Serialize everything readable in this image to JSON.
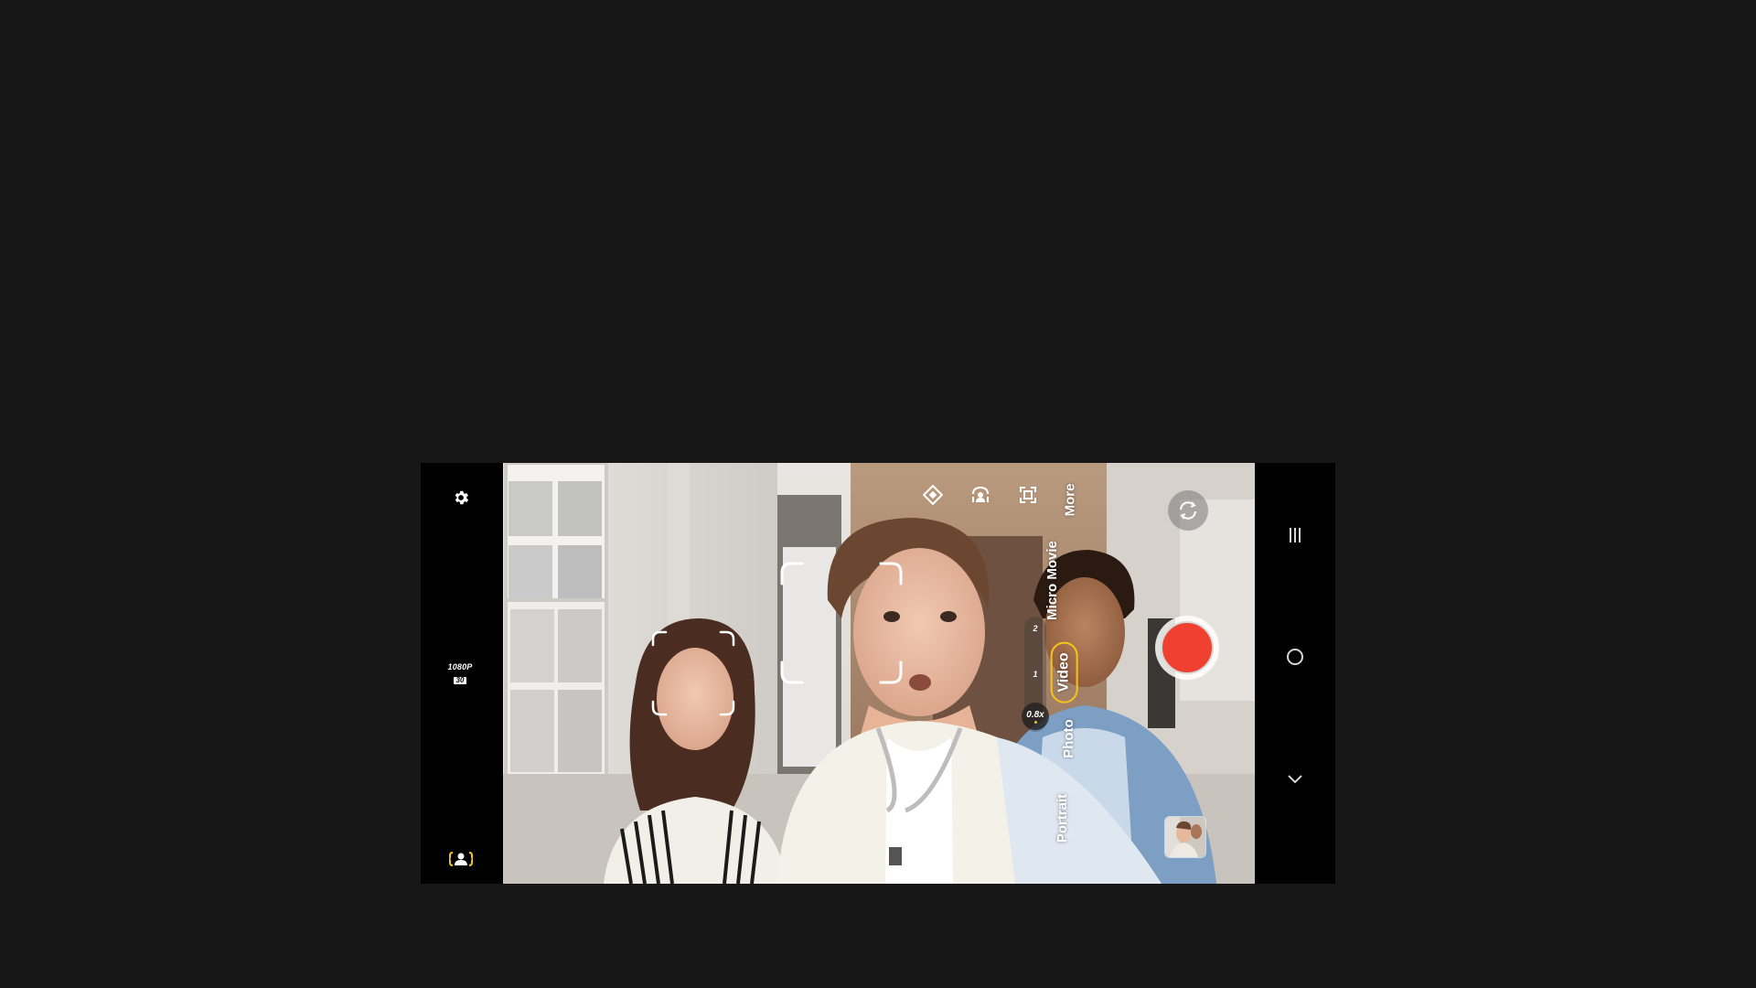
{
  "camera": {
    "resolution": "1080P",
    "framerate": "30",
    "modes": [
      "Portrait",
      "Photo",
      "Video",
      "Micro Movie",
      "More"
    ],
    "active_mode": "Video",
    "zoom": {
      "current": "0.8x",
      "ticks": [
        "2",
        "1"
      ]
    },
    "record_color": "#f0402f",
    "accent_color": "#f5c518"
  },
  "icons": {
    "settings": "gear-icon",
    "face_tracking": "face-tracking-icon",
    "stabilization": "stabilization-icon",
    "ai_subject": "ai-subject-icon",
    "frame": "frame-icon",
    "switch_camera": "switch-camera-icon",
    "recent_apps": "recent-apps-icon",
    "home": "home-icon",
    "back": "back-chevron-icon"
  }
}
